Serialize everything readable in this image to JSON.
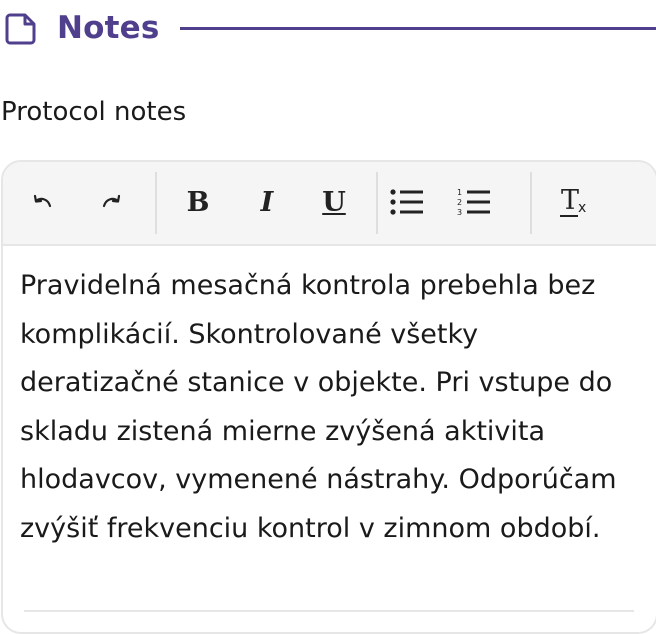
{
  "section": {
    "title": "Notes",
    "icon": "file-icon",
    "accent": "#4f3f8c"
  },
  "field": {
    "label": "Protocol notes"
  },
  "toolbar": {
    "buttons": [
      {
        "name": "undo",
        "icon": "undo-icon"
      },
      {
        "name": "redo",
        "icon": "redo-icon"
      },
      {
        "name": "bold",
        "label": "B"
      },
      {
        "name": "italic",
        "label": "I"
      },
      {
        "name": "underline",
        "label": "U"
      },
      {
        "name": "bullet-list",
        "icon": "bullet-list-icon"
      },
      {
        "name": "numbered-list",
        "icon": "numbered-list-icon"
      },
      {
        "name": "clear-formatting",
        "icon": "clear-formatting-icon"
      }
    ],
    "bold_label": "B",
    "italic_label": "I",
    "underline_label": "U",
    "clear_label_main": "T",
    "clear_label_sub": "x"
  },
  "editor": {
    "text": "Pravidelná mesačná kontrola prebehla bez komplikácií. Skontrolované všetky deratizačné stanice v objekte. Pri vstupe do skladu zistená mierne zvýšená aktivita hlodavcov, vymenené nástrahy. Odporúčam zvýšiť frekvenciu kontrol v zimnom období."
  }
}
